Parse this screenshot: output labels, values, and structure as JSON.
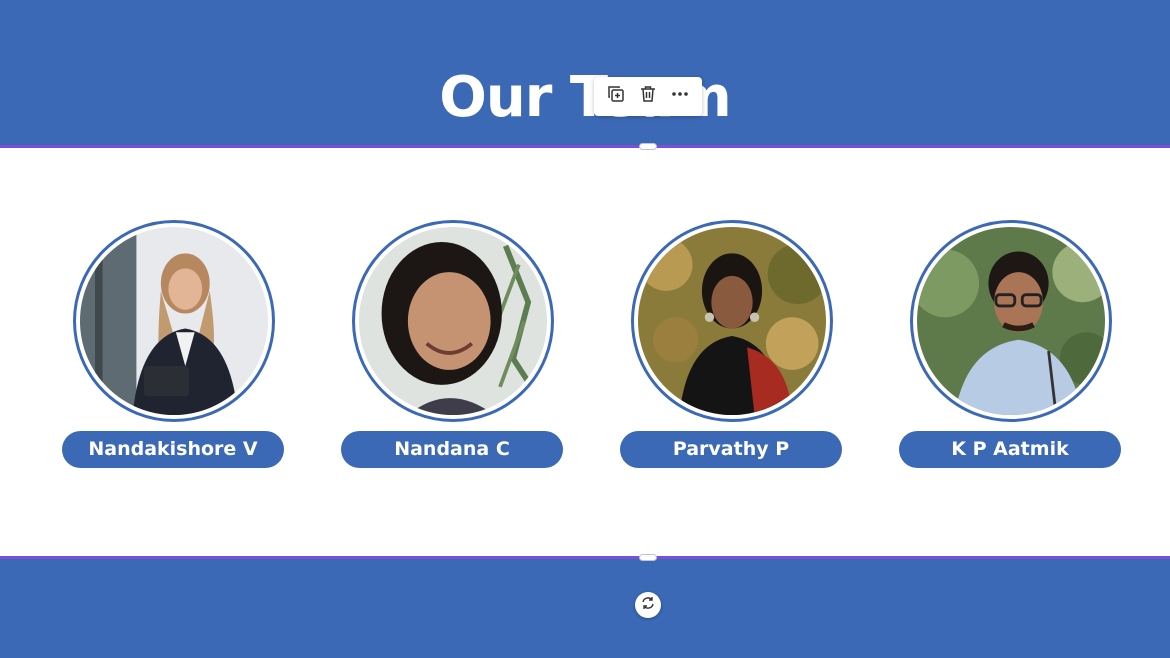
{
  "section": {
    "title": "Our Team"
  },
  "toolbar": {
    "duplicate_icon": "duplicate-icon",
    "delete_icon": "trash-icon",
    "more_icon": "more-horizontal-icon"
  },
  "members": [
    {
      "name": "Nandakishore V",
      "photo": "woman in dark blazer holding tablet by window"
    },
    {
      "name": "Nandana C",
      "photo": "smiling woman with curly dark hair, plants behind"
    },
    {
      "name": "Parvathy P",
      "photo": "woman in black top with red patterned shawl, outdoors"
    },
    {
      "name": "K P Aatmik",
      "photo": "man with glasses and light blue shirt, greenery behind"
    }
  ],
  "colors": {
    "band": "#3b69b5",
    "selection": "#7b4fd8",
    "text_on_band": "#ffffff"
  },
  "footer": {
    "refresh_icon": "refresh-icon"
  }
}
